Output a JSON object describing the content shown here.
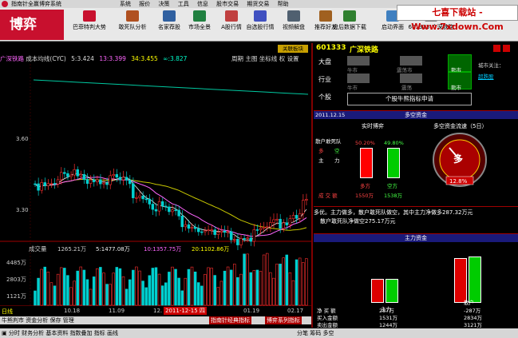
{
  "window": {
    "title": "指南针全赢博弈系统",
    "menu": [
      "系统",
      "报价",
      "决策",
      "工具",
      "信息",
      "股市交易",
      "期货交易",
      "帮助"
    ]
  },
  "watermark": "七喜下载站 -Www.7xdown.Com",
  "logo": "博弈",
  "toolbar": [
    {
      "label": "巴菲特判大势",
      "icon": "buffett-icon",
      "color": "#c8102e"
    },
    {
      "label": "敢死队分析",
      "icon": "tiger-icon",
      "color": "#b05020"
    },
    {
      "label": "名家荐股",
      "icon": "expert-icon",
      "color": "#3060a0"
    },
    {
      "label": "市场全景",
      "icon": "market-icon",
      "color": "#208040"
    },
    {
      "label": "A股行情",
      "icon": "quote-icon",
      "color": "#c04040"
    },
    {
      "label": "自选股行情",
      "icon": "favorite-icon",
      "color": "#4050c0"
    },
    {
      "label": "视频解盘",
      "icon": "video-icon",
      "color": "#506070"
    },
    {
      "label": "推荐好友",
      "icon": "friend-icon",
      "color": "#a06020"
    },
    {
      "label": "盘后数据下载",
      "icon": "download-icon",
      "color": "#308030"
    },
    {
      "label": "启动界面",
      "icon": "home-icon",
      "color": "#4080c0"
    },
    {
      "label": "601333 广深铁路",
      "icon": "stock-icon",
      "color": "#808080"
    }
  ],
  "stock": {
    "code": "601333",
    "name": "广深铁路",
    "button": "关联板块"
  },
  "chart": {
    "head_name": "广深铁路",
    "head_ma": "成本均线(CYC)",
    "cyc": [
      "5:3.424",
      "13:3.399",
      "34:3.455",
      "∞:3.827"
    ],
    "menu": [
      "周期",
      "主图",
      "坐标线",
      "权",
      "设置"
    ],
    "price_ticks": [
      "3.60",
      "3.30"
    ],
    "volume_label": "成交量",
    "volume_values": [
      "1265.21万",
      "5:1477.08万",
      "10:1357.75万",
      "20:1102.86万"
    ],
    "volume_ticks": [
      "4485万",
      "2803万",
      "1121万"
    ],
    "dates": [
      "10.18",
      "11.09",
      "12.",
      "01.19",
      "02.17"
    ],
    "cursor_date": "2011-12-15 四",
    "period": "日线"
  },
  "right": {
    "rows": [
      {
        "label": "大盘",
        "cells": [
          "牛市",
          "震荡市",
          "熊市"
        ]
      },
      {
        "label": "行业",
        "cells": [
          "牛市",
          "震荡",
          "熊市"
        ]
      },
      {
        "label": "个股",
        "button": "个股牛熊指标申请"
      }
    ],
    "city_label": "城市关注：",
    "city_link": "超跌股",
    "dk_title": "多空资金",
    "dk_date": "2011.12.15",
    "dk_realtime": "实时博弈",
    "dk_flow": "多空资金流速（5日）",
    "dk_items": [
      "散户敢死队",
      "多",
      "空",
      "主",
      "力"
    ],
    "pct_left": "50.20%",
    "pct_right": "49.80%",
    "bar_left": "多方",
    "bar_right": "空方",
    "val_left": "1550万",
    "val_right": "1538万",
    "volume_row": "成  交  额",
    "gauge_label": "多",
    "gauge_pct": "12.8%",
    "summary_1": "多优。主力做多，散户敢死队做空，其中主力净做多287.32万元",
    "summary_2": "散户敢死队净做空275.17万元",
    "zl_title": "主力资金",
    "zl_bar_left": "主力",
    "zl_bar_right": "散户",
    "zl_rows": [
      {
        "label": "净 买 额",
        "a": "287万",
        "b": "-287万"
      },
      {
        "label": "买入金额",
        "a": "1531万",
        "b": "2834万"
      },
      {
        "label": "卖出金额",
        "a": "1244万",
        "b": "3121万"
      }
    ]
  },
  "bottom": {
    "row1": [
      "牛熊判市",
      "资金分析",
      "保存",
      "管理"
    ],
    "btn_a": "指南针经典指标",
    "btn_b": "博弈系列指标",
    "tabs": [
      "分时",
      "财务分析",
      "基本资料",
      "指数叠加",
      "指标",
      "画线"
    ],
    "status_right": [
      "分笔",
      "筹码",
      "多空"
    ]
  },
  "chart_data": {
    "type": "candlestick",
    "price_ticks": [
      3.6,
      3.3
    ],
    "volume_ticks_wan": [
      4485,
      2803,
      1121
    ],
    "cyc": {
      "5": 3.424,
      "13": 3.399,
      "34": 3.455,
      "inf": 3.827
    },
    "volume": {
      "current_wan": 1265.21,
      "ma5_wan": 1477.08,
      "ma10_wan": 1357.75,
      "ma20_wan": 1102.86
    },
    "dates": [
      "10.18",
      "11.09",
      "12.",
      "01.19",
      "02.17"
    ]
  }
}
